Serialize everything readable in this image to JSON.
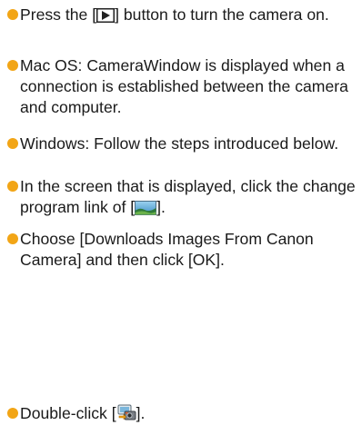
{
  "instructions": [
    {
      "before": "Press the [",
      "icon": "playback-button-icon",
      "after": "] button to turn the camera on."
    },
    {
      "text": "Mac OS: CameraWindow is displayed when a connection is established between the camera and computer."
    },
    {
      "text": "Windows: Follow the steps introduced below."
    },
    {
      "before": "In the screen that is displayed, click the change program link of [",
      "icon": "landscape-picture-icon",
      "after": "]."
    },
    {
      "text": "Choose [Downloads Images From Canon Camera] and then click [OK]."
    },
    {
      "before": "Double-click [",
      "icon": "camera-transfer-icon",
      "after": "]."
    }
  ],
  "colors": {
    "bullet": "#f2a516",
    "text": "#1a1a1a"
  }
}
